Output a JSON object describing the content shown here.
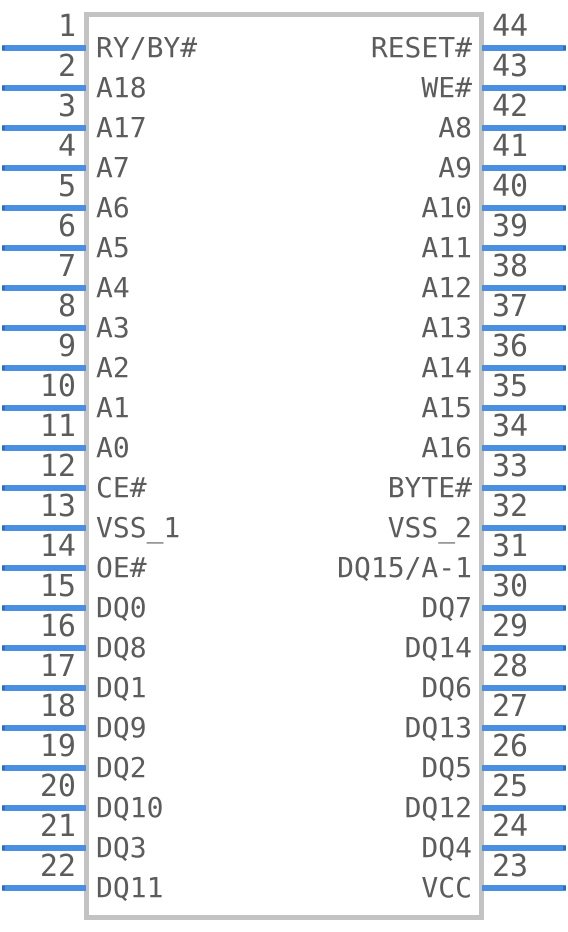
{
  "symbol": {
    "type": "schematic-pin-symbol",
    "package_pin_count": 44,
    "colors": {
      "pin_wire": "#4a90e2",
      "body_border": "#c3c3c3",
      "text": "#5c5c5c",
      "background": "#ffffff"
    },
    "left_pins": [
      {
        "number": "1",
        "name": "RY/BY#"
      },
      {
        "number": "2",
        "name": "A18"
      },
      {
        "number": "3",
        "name": "A17"
      },
      {
        "number": "4",
        "name": "A7"
      },
      {
        "number": "5",
        "name": "A6"
      },
      {
        "number": "6",
        "name": "A5"
      },
      {
        "number": "7",
        "name": "A4"
      },
      {
        "number": "8",
        "name": "A3"
      },
      {
        "number": "9",
        "name": "A2"
      },
      {
        "number": "10",
        "name": "A1"
      },
      {
        "number": "11",
        "name": "A0"
      },
      {
        "number": "12",
        "name": "CE#"
      },
      {
        "number": "13",
        "name": "VSS_1"
      },
      {
        "number": "14",
        "name": "OE#"
      },
      {
        "number": "15",
        "name": "DQ0"
      },
      {
        "number": "16",
        "name": "DQ8"
      },
      {
        "number": "17",
        "name": "DQ1"
      },
      {
        "number": "18",
        "name": "DQ9"
      },
      {
        "number": "19",
        "name": "DQ2"
      },
      {
        "number": "20",
        "name": "DQ10"
      },
      {
        "number": "21",
        "name": "DQ3"
      },
      {
        "number": "22",
        "name": "DQ11"
      }
    ],
    "right_pins": [
      {
        "number": "44",
        "name": "RESET#"
      },
      {
        "number": "43",
        "name": "WE#"
      },
      {
        "number": "42",
        "name": "A8"
      },
      {
        "number": "41",
        "name": "A9"
      },
      {
        "number": "40",
        "name": "A10"
      },
      {
        "number": "39",
        "name": "A11"
      },
      {
        "number": "38",
        "name": "A12"
      },
      {
        "number": "37",
        "name": "A13"
      },
      {
        "number": "36",
        "name": "A14"
      },
      {
        "number": "35",
        "name": "A15"
      },
      {
        "number": "34",
        "name": "A16"
      },
      {
        "number": "33",
        "name": "BYTE#"
      },
      {
        "number": "32",
        "name": "VSS_2"
      },
      {
        "number": "31",
        "name": "DQ15/A-1"
      },
      {
        "number": "30",
        "name": "DQ7"
      },
      {
        "number": "29",
        "name": "DQ14"
      },
      {
        "number": "28",
        "name": "DQ6"
      },
      {
        "number": "27",
        "name": "DQ13"
      },
      {
        "number": "26",
        "name": "DQ5"
      },
      {
        "number": "25",
        "name": "DQ12"
      },
      {
        "number": "24",
        "name": "DQ4"
      },
      {
        "number": "23",
        "name": "VCC"
      }
    ]
  }
}
